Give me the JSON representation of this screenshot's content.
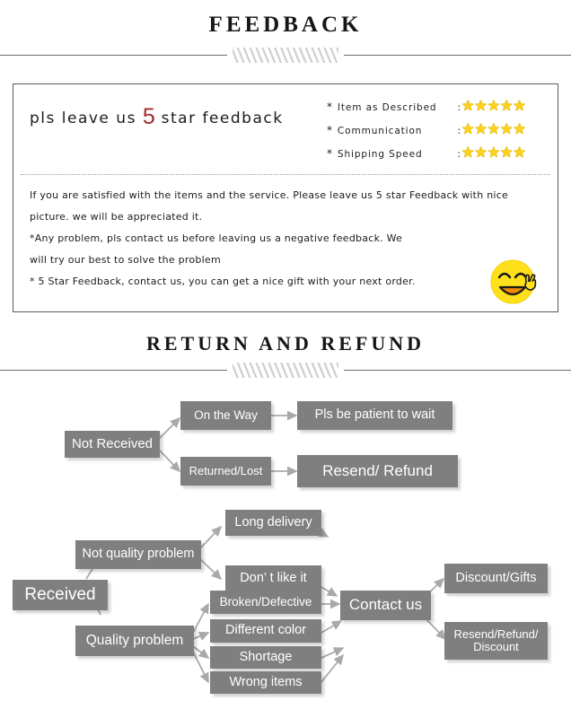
{
  "sections": {
    "feedback_title": "FEEDBACK",
    "return_title": "RETURN AND REFUND"
  },
  "feedback": {
    "headline_before": "pls leave us ",
    "headline_number": "5",
    "headline_after": " star feedback",
    "ratings": [
      {
        "asterisk": "*",
        "label": "Item as Described",
        "colon": ":",
        "stars": 5
      },
      {
        "asterisk": "*",
        "label": "Communication",
        "colon": ":",
        "stars": 5
      },
      {
        "asterisk": "*",
        "label": "Shipping Speed",
        "colon": ":",
        "stars": 5
      }
    ],
    "star_glyph": "★",
    "star_color": "#ffd21e",
    "body_lines": [
      "If you are satisfied with the items and the service. Please leave us 5 star Feedback with nice",
      "picture. we will be appreciated it.",
      "*Any problem, pls contact us before leaving us a negative feedback. We",
      "will try our best to solve  the problem",
      "* 5 Star Feedback, contact us, you can get a nice gift with your next order."
    ],
    "smiley_icon": "smiley-face-peace-icon"
  },
  "flowchart": {
    "box_color": "#7f7f7f",
    "text_color": "#ffffff",
    "arrow_color": "#a9a9a9",
    "nodes": [
      {
        "id": "not_received",
        "label": "Not Received"
      },
      {
        "id": "on_the_way",
        "label": "On the Way"
      },
      {
        "id": "pls_be_patient",
        "label": "Pls be patient to wait"
      },
      {
        "id": "returned_lost",
        "label": "Returned/Lost"
      },
      {
        "id": "resend_refund",
        "label": "Resend/ Refund"
      },
      {
        "id": "received",
        "label": "Received"
      },
      {
        "id": "not_quality",
        "label": "Not quality problem"
      },
      {
        "id": "quality",
        "label": "Quality problem"
      },
      {
        "id": "long_delivery",
        "label": "Long delivery"
      },
      {
        "id": "dont_like_it",
        "label": "Don’ t like it"
      },
      {
        "id": "broken_defective",
        "label": "Broken/Defective"
      },
      {
        "id": "different_color",
        "label": "Different color"
      },
      {
        "id": "shortage",
        "label": "Shortage"
      },
      {
        "id": "wrong_items",
        "label": "Wrong items"
      },
      {
        "id": "contact_us",
        "label": "Contact us"
      },
      {
        "id": "discount_gifts",
        "label": "Discount/Gifts"
      },
      {
        "id": "resend_refund_disc",
        "label": "Resend/Refund/\nDiscount"
      }
    ]
  }
}
